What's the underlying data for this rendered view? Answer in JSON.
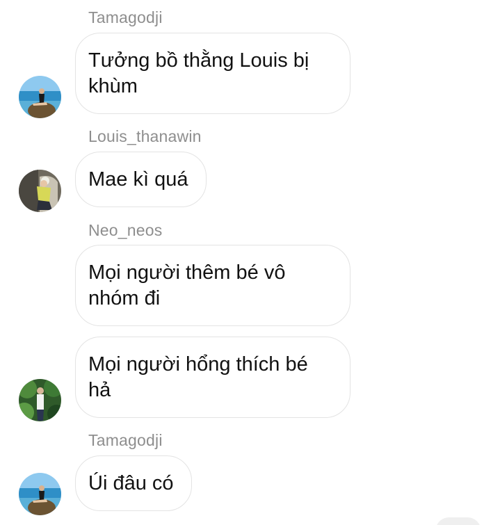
{
  "messages": [
    {
      "sender": "Tamagodji",
      "lines": [
        "Tưởng bồ thằng Louis bị",
        "khùm"
      ],
      "avatar_icon": "beach-rock-avatar-icon"
    },
    {
      "sender": "Louis_thanawin",
      "lines": [
        "Mae kì quá"
      ],
      "avatar_icon": "car-seat-avatar-icon"
    },
    {
      "sender": "Neo_neos",
      "lines": [
        "Mọi người thêm bé vô",
        "nhóm đi"
      ]
    },
    {
      "lines": [
        "Mọi người hổng thích bé",
        "hả"
      ],
      "avatar_icon": "garden-avatar-icon"
    },
    {
      "sender": "Tamagodji",
      "lines": [
        "Úi đâu có"
      ],
      "avatar_icon": "beach-rock-avatar-icon"
    }
  ],
  "colors": {
    "sender_text": "#8e8e8e",
    "message_text": "#111111",
    "bubble_border": "#e3e3e3",
    "background": "#ffffff"
  }
}
